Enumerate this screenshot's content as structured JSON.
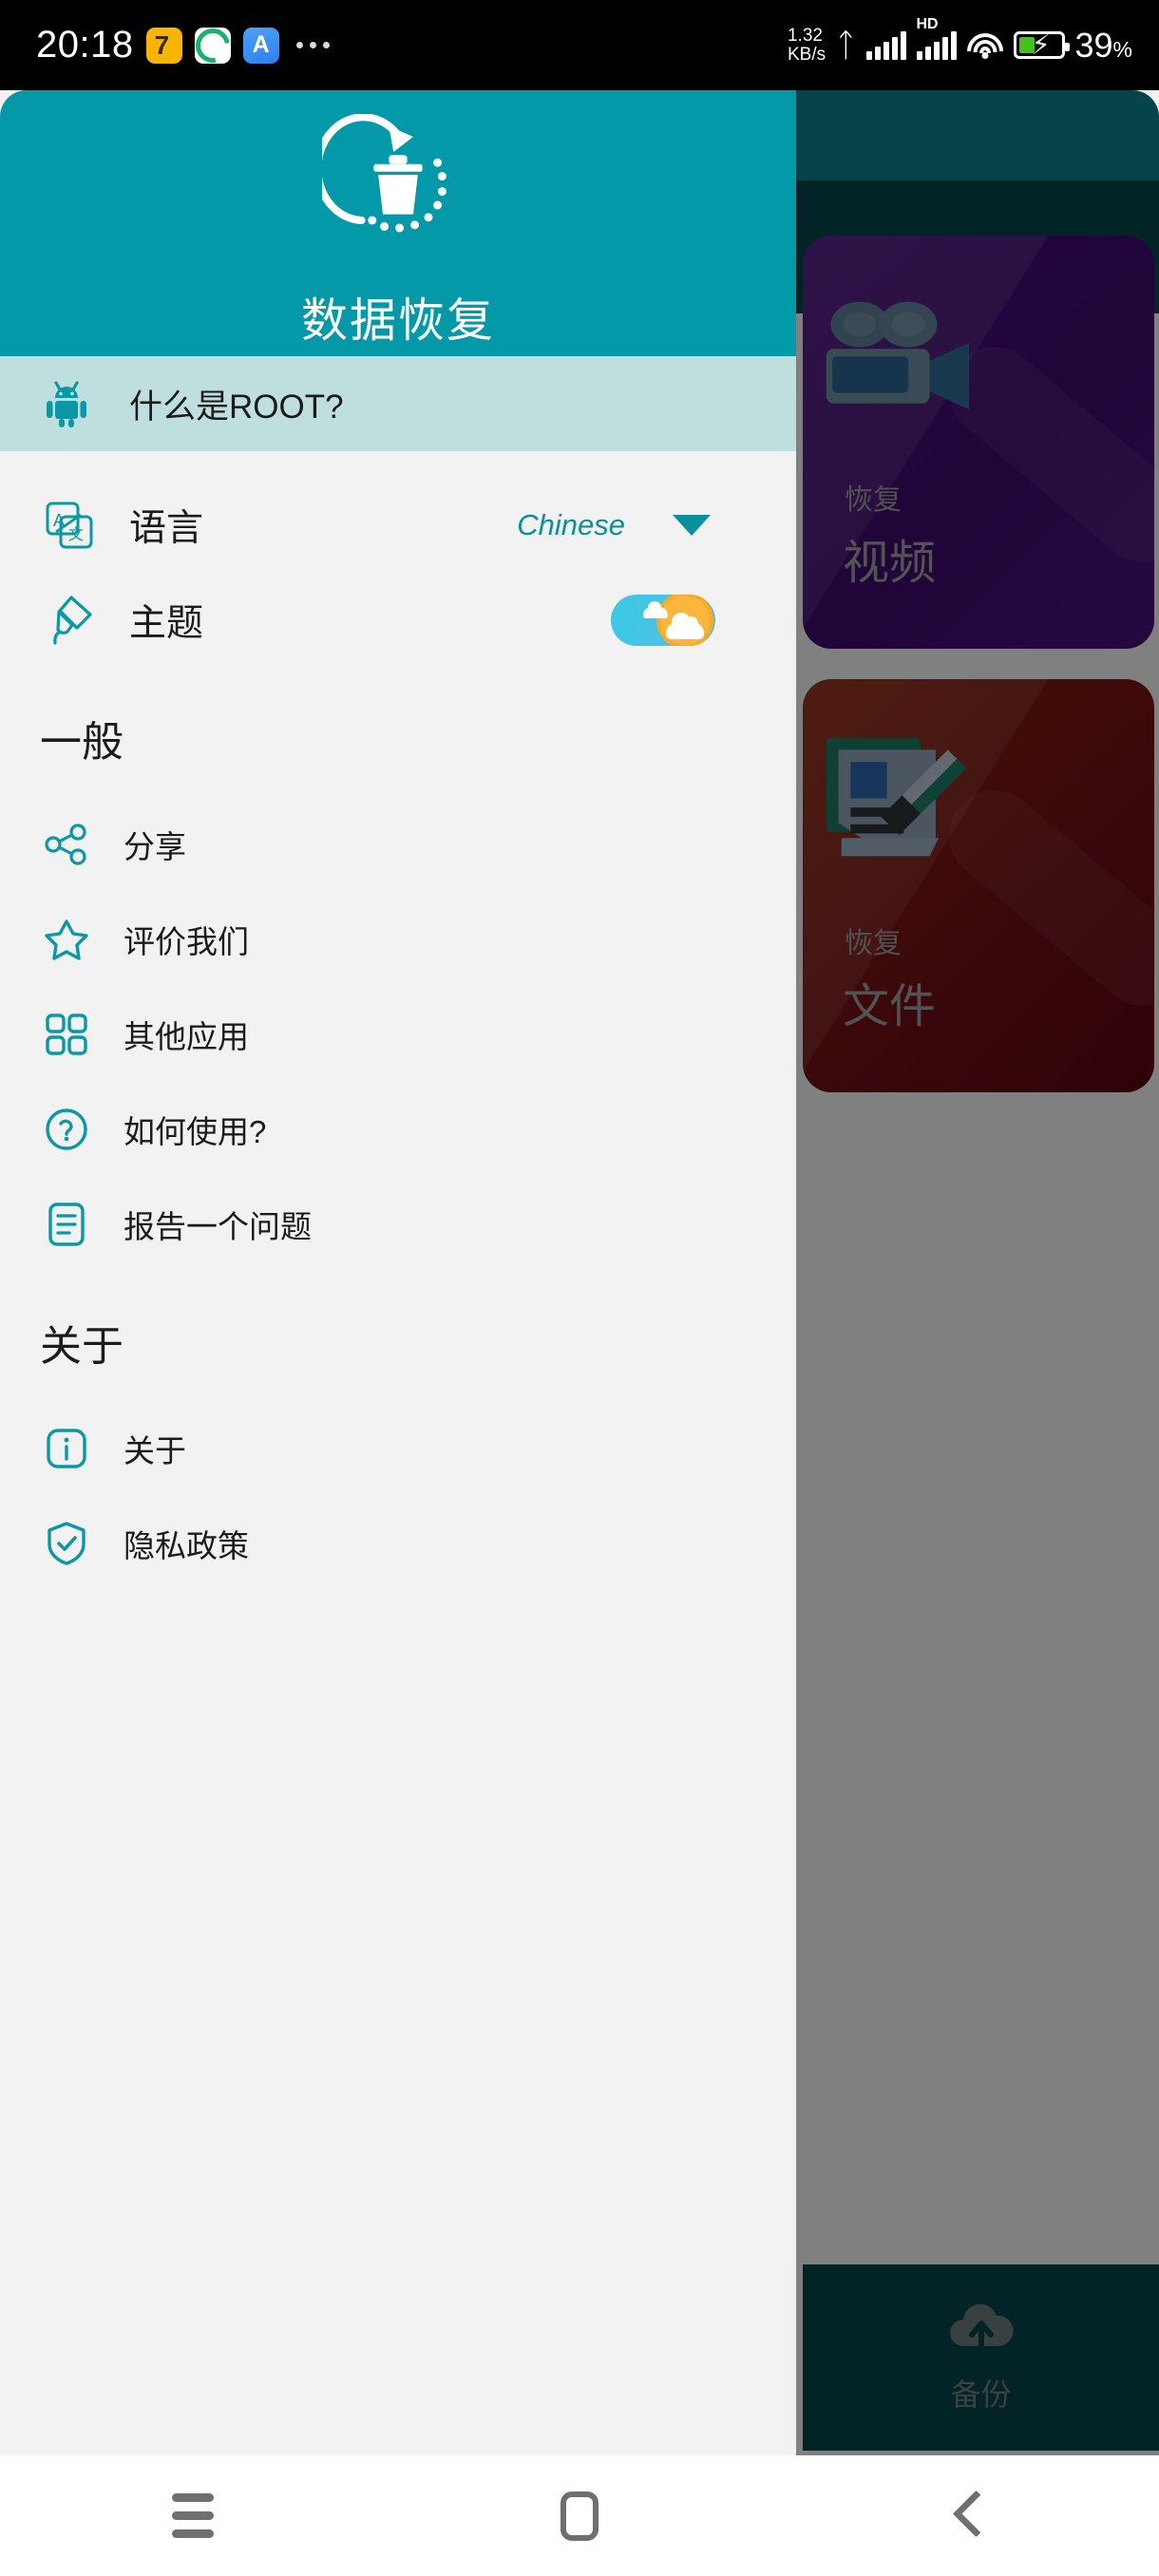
{
  "statusbar": {
    "clock": "20:18",
    "net_rate": "1.32",
    "net_unit": "KB/s",
    "hd_label": "HD",
    "battery_percent": "39",
    "battery_percent_symbol": "%",
    "app_icons": [
      "cat-app-icon",
      "green-app-icon",
      "blue-app-icon"
    ],
    "overflow": "more-notifications-icon"
  },
  "drawer": {
    "title": "数据恢复",
    "logo_icon": "trash-restore-icon",
    "root_item": {
      "label": "什么是ROOT?",
      "icon": "android-robot-icon"
    },
    "language": {
      "label": "语言",
      "icon": "translate-icon",
      "value": "Chinese",
      "caret": "chevron-down-icon"
    },
    "theme": {
      "label": "主题",
      "icon": "paint-brush-icon",
      "toggle_state": "day",
      "toggle_icon": "sun-cloud-toggle"
    },
    "sections": [
      {
        "heading": "一般",
        "items": [
          {
            "label": "分享",
            "icon": "share-icon"
          },
          {
            "label": "评价我们",
            "icon": "star-icon"
          },
          {
            "label": "其他应用",
            "icon": "grid-apps-icon"
          },
          {
            "label": "如何使用?",
            "icon": "question-circle-icon"
          },
          {
            "label": "报告一个问题",
            "icon": "report-document-icon"
          }
        ]
      },
      {
        "heading": "关于",
        "items": [
          {
            "label": "关于",
            "icon": "info-icon"
          },
          {
            "label": "隐私政策",
            "icon": "shield-check-icon"
          }
        ]
      }
    ]
  },
  "background_app": {
    "cards": [
      {
        "kicker": "恢复",
        "title": "视频",
        "icon": "video-camera-icon",
        "color": "#46107a"
      },
      {
        "kicker": "恢复",
        "title": "文件",
        "icon": "document-pen-icon",
        "color": "#6d0f15"
      }
    ],
    "bottom_bar": {
      "label": "备份",
      "icon": "cloud-upload-icon"
    }
  },
  "navbar": {
    "recents": "recents-icon",
    "home": "home-icon",
    "back": "back-icon"
  },
  "colors": {
    "primary_teal": "#0399a8",
    "dark_teal": "#04444a",
    "root_row_bg": "#bfdfdf",
    "drawer_bg": "#f2f2f2",
    "accent_text": "#0a8f9c"
  }
}
